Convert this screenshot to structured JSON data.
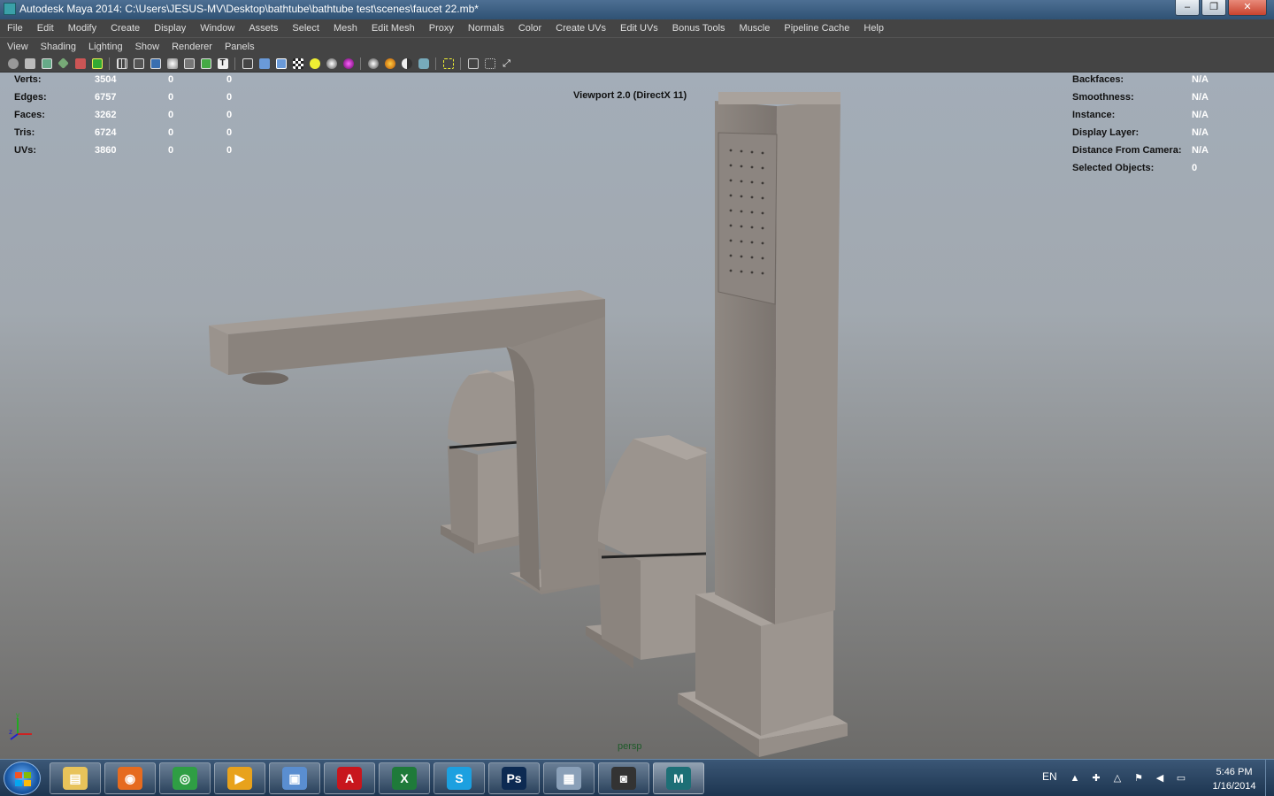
{
  "window": {
    "title": "Autodesk Maya 2014: C:\\Users\\JESUS-MV\\Desktop\\bathtube\\bathtube test\\scenes\\faucet 22.mb*",
    "controls": [
      "–",
      "❐",
      "✕"
    ]
  },
  "menu": [
    "File",
    "Edit",
    "Modify",
    "Create",
    "Display",
    "Window",
    "Assets",
    "Select",
    "Mesh",
    "Edit Mesh",
    "Proxy",
    "Normals",
    "Color",
    "Create UVs",
    "Edit UVs",
    "Bonus Tools",
    "Muscle",
    "Pipeline Cache",
    "Help"
  ],
  "panel_menu": [
    "View",
    "Shading",
    "Lighting",
    "Show",
    "Renderer",
    "Panels"
  ],
  "hud_left": [
    {
      "label": "Verts:",
      "c1": "3504",
      "c2": "0",
      "c3": "0"
    },
    {
      "label": "Edges:",
      "c1": "6757",
      "c2": "0",
      "c3": "0"
    },
    {
      "label": "Faces:",
      "c1": "3262",
      "c2": "0",
      "c3": "0"
    },
    {
      "label": "Tris:",
      "c1": "6724",
      "c2": "0",
      "c3": "0"
    },
    {
      "label": "UVs:",
      "c1": "3860",
      "c2": "0",
      "c3": "0"
    }
  ],
  "hud_right": [
    {
      "label": "Backfaces:",
      "value": "N/A"
    },
    {
      "label": "Smoothness:",
      "value": "N/A"
    },
    {
      "label": "Instance:",
      "value": "N/A"
    },
    {
      "label": "Display Layer:",
      "value": "N/A"
    },
    {
      "label": "Distance From Camera:",
      "value": "N/A"
    },
    {
      "label": "Selected Objects:",
      "value": "0"
    }
  ],
  "viewport": {
    "renderer_label": "Viewport 2.0 (DirectX 11)",
    "camera_label": "persp"
  },
  "taskbar": {
    "apps": [
      {
        "name": "file-explorer",
        "glyph": "▤",
        "color": "#e8c35a"
      },
      {
        "name": "firefox",
        "glyph": "◉",
        "color": "#e66b1f"
      },
      {
        "name": "chrome",
        "glyph": "◎",
        "color": "#2f9e44"
      },
      {
        "name": "media-player",
        "glyph": "▶",
        "color": "#e8a21c"
      },
      {
        "name": "photo-viewer",
        "glyph": "▣",
        "color": "#5a8ed0"
      },
      {
        "name": "acrobat",
        "glyph": "A",
        "color": "#c8161d"
      },
      {
        "name": "excel",
        "glyph": "X",
        "color": "#1f7a3a"
      },
      {
        "name": "skype",
        "glyph": "S",
        "color": "#1ca0e0"
      },
      {
        "name": "photoshop",
        "glyph": "Ps",
        "color": "#0c2a52"
      },
      {
        "name": "calculator",
        "glyph": "▦",
        "color": "#8aa0b8"
      },
      {
        "name": "camera",
        "glyph": "◙",
        "color": "#333333"
      },
      {
        "name": "maya",
        "glyph": "M",
        "color": "#1d6f76"
      }
    ],
    "language": "EN",
    "time": "5:46 PM",
    "date": "1/16/2014"
  },
  "colors": {
    "model_base": "#8c847e",
    "model_light": "#a69f99",
    "model_dark": "#6d6661",
    "hud_value": "#ffffff"
  }
}
